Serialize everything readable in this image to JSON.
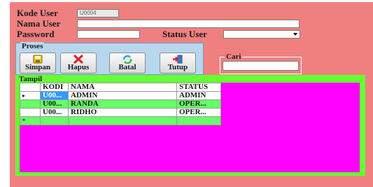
{
  "form": {
    "kode_user_label": "Kode User",
    "kode_user_value": "U0004",
    "nama_user_label": "Nama User",
    "nama_user_value": "",
    "password_label": "Password",
    "password_value": "",
    "status_user_label": "Status User",
    "status_user_value": ""
  },
  "proses": {
    "title": "Proses",
    "buttons": {
      "simpan": "Simpan",
      "hapus": "Hapus",
      "batal": "Batal",
      "tutup": "Tutup"
    }
  },
  "cari": {
    "title": "Cari",
    "value": ""
  },
  "tampil": {
    "title": "Tampil",
    "columns": [
      "KODI",
      "NAMA",
      "STATUS"
    ],
    "rows": [
      {
        "indicator": "▸",
        "kode": "U00...",
        "nama": "ADMIN",
        "status": "ADMIN"
      },
      {
        "indicator": "",
        "kode": "U00...",
        "nama": "RANDA",
        "status": "OPER..."
      },
      {
        "indicator": "",
        "kode": "U00...",
        "nama": "RIDHO",
        "status": "OPER..."
      }
    ],
    "new_row_indicator": "*"
  },
  "colors": {
    "form_bg": "#f08080",
    "proses_bg": "#b7d7ee",
    "tampil_bg": "#66ff33",
    "grid_bg": "#ff00ff",
    "selection": "#3399ff"
  }
}
